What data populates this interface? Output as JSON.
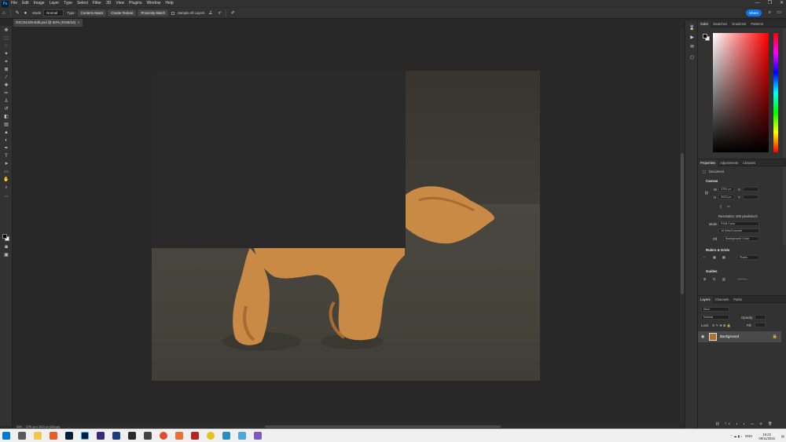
{
  "menubar": {
    "app_logo": "Ps",
    "items": [
      "File",
      "Edit",
      "Image",
      "Layer",
      "Type",
      "Select",
      "Filter",
      "3D",
      "View",
      "Plugins",
      "Window",
      "Help"
    ],
    "window_controls": [
      "—",
      "❐",
      "✕"
    ]
  },
  "options": {
    "mode_label": "Mode:",
    "mode_value": "Normal",
    "type_label": "Type:",
    "type_buttons": [
      "Content-Aware",
      "Create Texture",
      "Proximity Match"
    ],
    "sample_all_layers": "Sample All Layers",
    "angle_value": "0°",
    "share_label": "Share"
  },
  "document": {
    "tab_title": "DSC04425-Edit.psd @ 50% (RGB/16)",
    "tab_close": "×"
  },
  "status": {
    "zoom": "50%",
    "dimensions": "3791 px x 3023 px (300 ppi)"
  },
  "color_panel": {
    "tabs": [
      "Color",
      "Swatches",
      "Gradients",
      "Patterns"
    ]
  },
  "properties_panel": {
    "tabs": [
      "Properties",
      "Adjustments",
      "Libraries"
    ],
    "document_label": "Document",
    "canvas_heading": "Canvas",
    "w_label": "W",
    "w_value": "3791 px",
    "h_label": "H",
    "h_value": "3023 px",
    "x_label": "X",
    "y_label": "Y",
    "resolution": "Resolution: 300 pixels/inch",
    "mode_label": "Mode",
    "mode_value": "RGB Color",
    "bit_depth": "16 Bits/Channel",
    "fill_label": "Fill",
    "fill_value": "Background Color",
    "rulers_heading": "Rulers & Grids",
    "rulers_unit": "Pixels",
    "guides_heading": "Guides"
  },
  "layers_panel": {
    "tabs": [
      "Layers",
      "Channels",
      "Paths"
    ],
    "search_placeholder": "Kind",
    "blend_mode": "Normal",
    "opacity_label": "Opacity:",
    "lock_label": "Lock:",
    "fill_label": "Fill:",
    "layers": [
      {
        "name": "Background"
      }
    ]
  },
  "taskbar": {
    "language": "ENG",
    "time": "16:22",
    "date": "09/11/2022"
  },
  "colors": {
    "accent": "#1473e6",
    "ui_dark": "#323232",
    "canvas_bg": "#282828",
    "fur": "#c98a45"
  }
}
